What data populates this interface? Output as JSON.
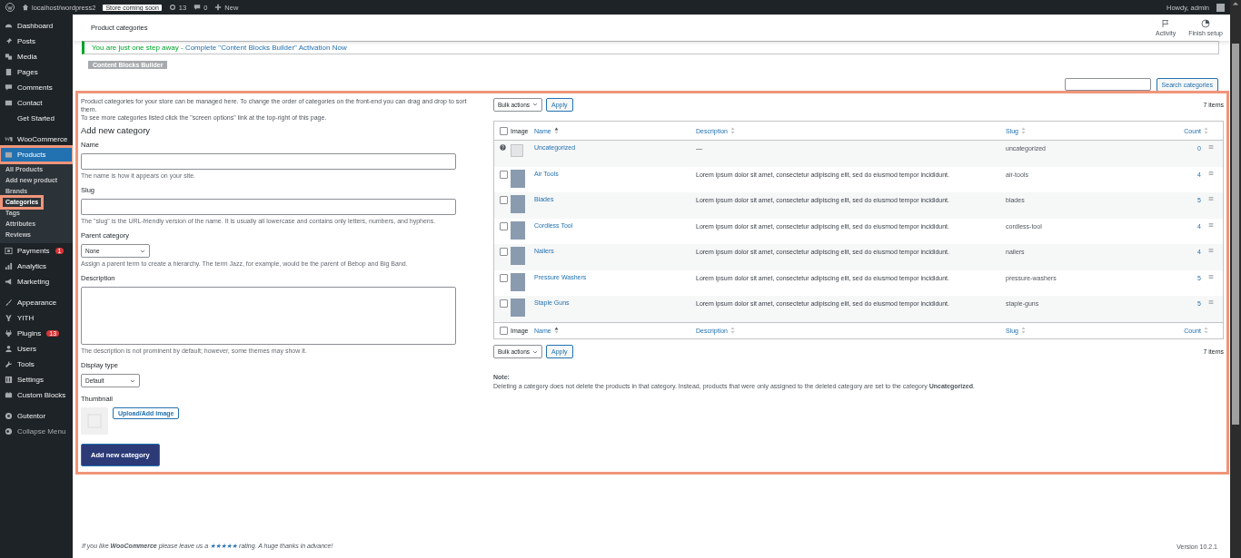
{
  "admin_bar": {
    "site": "localhost/wordpress2",
    "badge": "Store coming soon",
    "updates": "13",
    "comments": "0",
    "new": "New",
    "greeting": "Howdy, admin"
  },
  "sidebar": {
    "groups": [
      [
        {
          "label": "Dashboard",
          "selected": false,
          "highlighted": false
        },
        {
          "label": "Posts",
          "selected": false,
          "highlighted": false
        },
        {
          "label": "Media",
          "selected": false,
          "highlighted": false
        },
        {
          "label": "Pages",
          "selected": false,
          "highlighted": false
        },
        {
          "label": "Comments",
          "selected": false,
          "highlighted": false
        },
        {
          "label": "Contact",
          "selected": false,
          "highlighted": false
        },
        {
          "label": "Get Started",
          "selected": false,
          "highlighted": false
        }
      ],
      [
        {
          "label": "WooCommerce",
          "selected": false,
          "highlighted": false
        },
        {
          "label": "Products",
          "selected": true,
          "highlighted": true,
          "children": [
            {
              "label": "All Products",
              "selected": false,
              "highlighted": false
            },
            {
              "label": "Add new product",
              "selected": false,
              "highlighted": false
            },
            {
              "label": "Brands",
              "selected": false,
              "highlighted": false
            },
            {
              "label": "Categories",
              "selected": true,
              "highlighted": true
            },
            {
              "label": "Tags",
              "selected": false,
              "highlighted": false
            },
            {
              "label": "Attributes",
              "selected": false,
              "highlighted": false
            },
            {
              "label": "Reviews",
              "selected": false,
              "highlighted": false
            }
          ]
        },
        {
          "label": "Payments",
          "selected": false,
          "highlighted": false,
          "badge": "1"
        },
        {
          "label": "Analytics",
          "selected": false,
          "highlighted": false
        },
        {
          "label": "Marketing",
          "selected": false,
          "highlighted": false
        }
      ],
      [
        {
          "label": "Appearance",
          "selected": false,
          "highlighted": false
        },
        {
          "label": "YITH",
          "selected": false,
          "highlighted": false
        },
        {
          "label": "Plugins",
          "selected": false,
          "highlighted": false,
          "badge": "13"
        },
        {
          "label": "Users",
          "selected": false,
          "highlighted": false
        },
        {
          "label": "Tools",
          "selected": false,
          "highlighted": false
        },
        {
          "label": "Settings",
          "selected": false,
          "highlighted": false
        },
        {
          "label": "Custom Blocks",
          "selected": false,
          "highlighted": false
        }
      ],
      [
        {
          "label": "Gutentor",
          "selected": false,
          "highlighted": false
        },
        {
          "label": "Collapse Menu",
          "selected": false,
          "highlighted": false
        }
      ]
    ]
  },
  "header": {
    "title": "Product categories",
    "actions": [
      {
        "label": "Activity"
      },
      {
        "label": "Finish setup"
      }
    ]
  },
  "notice": {
    "text": "You are just one step away - ",
    "link": "Complete \"Content Blocks Builder\" Activation Now",
    "button": "Content Blocks Builder"
  },
  "search": {
    "button": "Search categories"
  },
  "form": {
    "highlighted": true,
    "intro": [
      "Product categories for your store can be managed here. To change the order of categories on the front-end you can drag and drop to sort them.",
      "To see more categories listed click the \"screen options\" link at the top-right of this page."
    ],
    "heading": "Add new category",
    "fields": [
      {
        "kind": "text",
        "label": "Name",
        "help": "The name is how it appears on your site."
      },
      {
        "kind": "text",
        "label": "Slug",
        "help": "The \"slug\" is the URL-friendly version of the name. It is usually all lowercase and contains only letters, numbers, and hyphens."
      },
      {
        "kind": "select",
        "label": "Parent category",
        "value": "None",
        "help": "Assign a parent term to create a hierarchy. The term Jazz, for example, would be the parent of Bebop and Big Band."
      },
      {
        "kind": "textarea",
        "label": "Description",
        "help": "The description is not prominent by default; however, some themes may show it."
      },
      {
        "kind": "select",
        "label": "Display type",
        "value": "Default"
      },
      {
        "kind": "thumbnail",
        "label": "Thumbnail",
        "button": "Upload/Add image"
      }
    ],
    "submit": "Add new category"
  },
  "table": {
    "top_bar": {
      "bulk": "Bulk actions",
      "apply": "Apply",
      "count": "7 items"
    },
    "header": {
      "select_all_checked": false,
      "columns": [
        {
          "label": "Image",
          "sortable": false
        },
        {
          "label": "Name",
          "sortable": true,
          "sorted": true
        },
        {
          "label": "Description",
          "sortable": true,
          "sorted": false
        },
        {
          "label": "Slug",
          "sortable": true,
          "sorted": false
        },
        {
          "label": "Count",
          "sortable": true,
          "sorted": false
        }
      ]
    },
    "footer_header": {
      "select_all_checked": false,
      "columns": [
        {
          "label": "Image",
          "sortable": false
        },
        {
          "label": "Name",
          "sortable": true,
          "sorted": true
        },
        {
          "label": "Description",
          "sortable": true,
          "sorted": false
        },
        {
          "label": "Slug",
          "sortable": true,
          "sorted": false
        },
        {
          "label": "Count",
          "sortable": true,
          "sorted": false
        }
      ]
    },
    "bottom_bar": {
      "bulk": "Bulk actions",
      "apply": "Apply",
      "count": "7 items"
    },
    "rows": [
      {
        "kind": "default",
        "name": "Uncategorized",
        "description": "—",
        "slug": "uncategorized",
        "count": "0"
      },
      {
        "kind": "normal",
        "checked": false,
        "name": "Air Tools",
        "description": "Lorem ipsum dolor sit amet, consectetur adipiscing elit, sed do eiusmod tempor incididunt.",
        "slug": "air-tools",
        "count": "4"
      },
      {
        "kind": "normal",
        "checked": false,
        "name": "Blades",
        "description": "Lorem ipsum dolor sit amet, consectetur adipiscing elit, sed do eiusmod tempor incididunt.",
        "slug": "blades",
        "count": "5"
      },
      {
        "kind": "normal",
        "checked": false,
        "name": "Cordless Tool",
        "description": "Lorem ipsum dolor sit amet, consectetur adipiscing elit, sed do eiusmod tempor incididunt.",
        "slug": "cordless-tool",
        "count": "4"
      },
      {
        "kind": "normal",
        "checked": false,
        "name": "Nailers",
        "description": "Lorem ipsum dolor sit amet, consectetur adipiscing elit, sed do eiusmod tempor incididunt.",
        "slug": "nailers",
        "count": "4"
      },
      {
        "kind": "normal",
        "checked": false,
        "name": "Pressure Washers",
        "description": "Lorem ipsum dolor sit amet, consectetur adipiscing elit, sed do eiusmod tempor incididunt.",
        "slug": "pressure-washers",
        "count": "5"
      },
      {
        "kind": "normal",
        "checked": false,
        "name": "Staple Guns",
        "description": "Lorem ipsum dolor sit amet, consectetur adipiscing elit, sed do eiusmod tempor incididunt.",
        "slug": "staple-guns",
        "count": "5"
      }
    ],
    "note_title": "Note:",
    "note": "Deleting a category does not delete the products in that category. Instead, products that were only assigned to the deleted category are set to the category **Uncategorized**."
  },
  "footer": {
    "before": "If you like **WooCommerce** please leave us a ",
    "rating": "★★★★★",
    "after": " rating. A huge thanks in advance!",
    "version": "Version 10.2.1"
  }
}
